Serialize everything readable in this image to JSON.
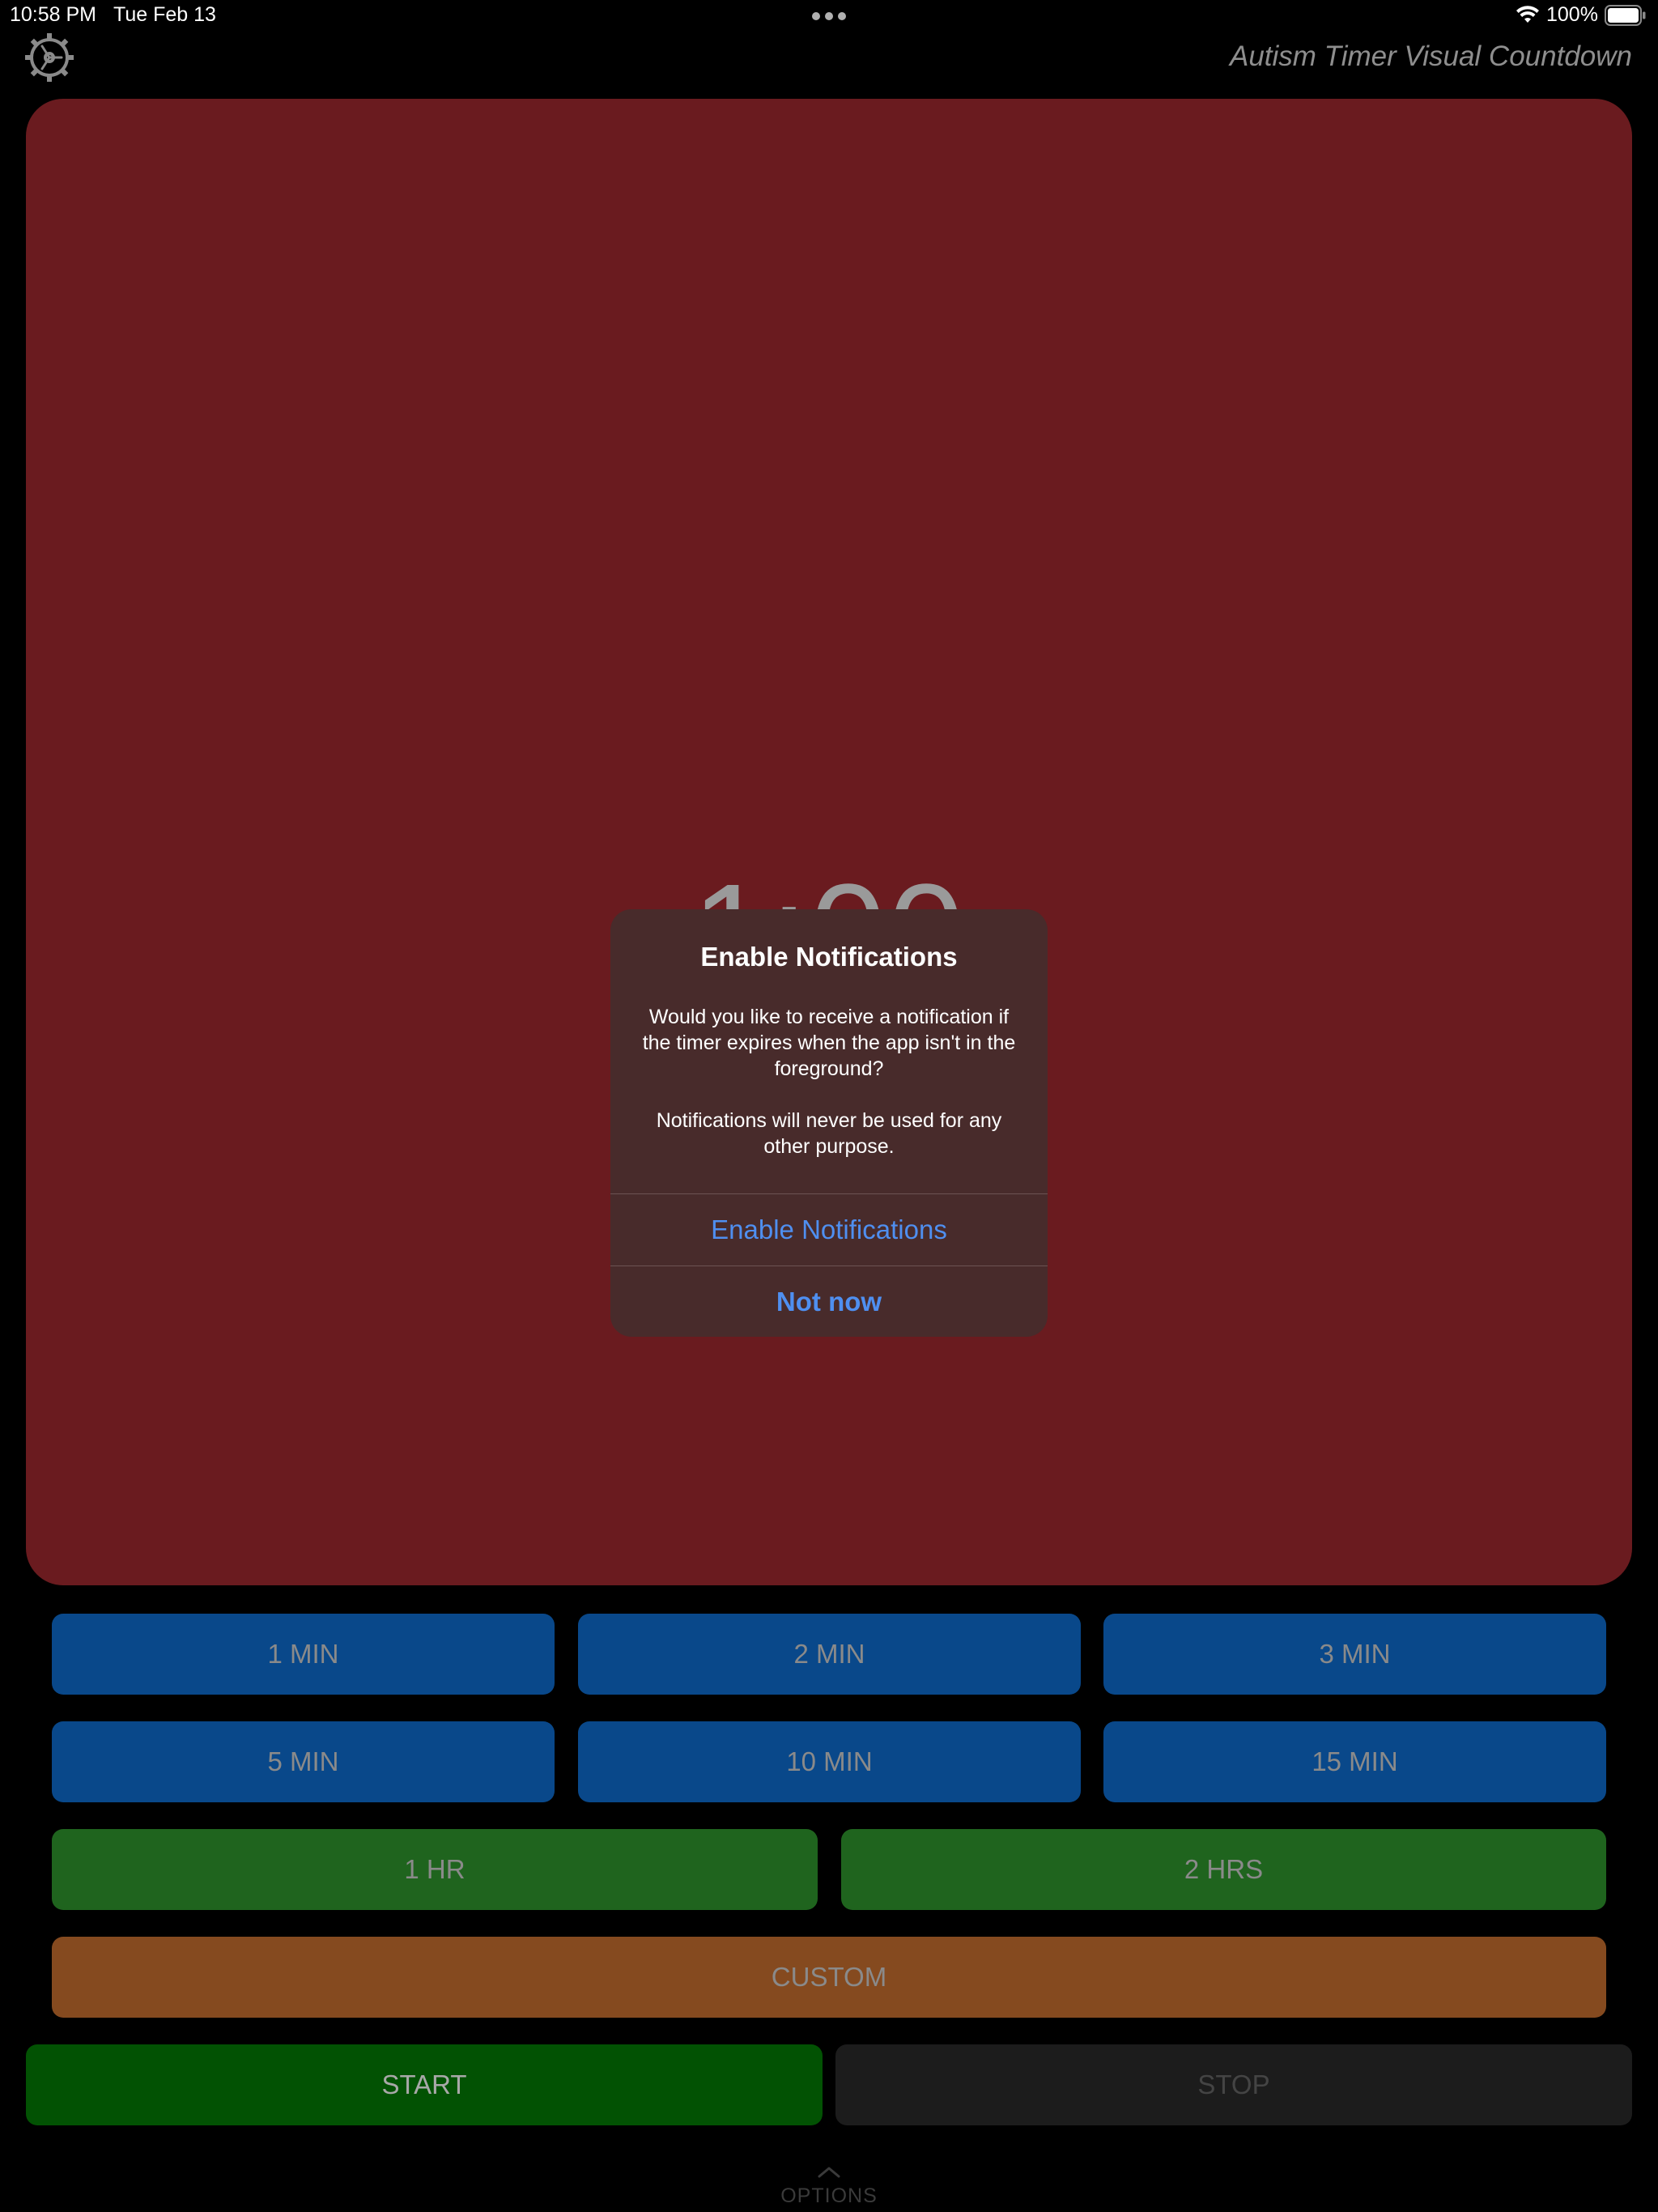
{
  "status_bar": {
    "time": "10:58 PM",
    "date": "Tue Feb 13",
    "battery_percent": "100%",
    "icons": [
      "multitask-dots",
      "wifi-icon",
      "battery-icon"
    ]
  },
  "header": {
    "settings_icon": "gear-icon",
    "title": "Autism Timer Visual Countdown"
  },
  "timer": {
    "display": "1:00",
    "panel_color": "#6a1b1f"
  },
  "alert": {
    "title": "Enable Notifications",
    "message": "Would you like to receive a notification if the timer expires when the app isn't in the foreground?\n\nNotifications will never be used for any other purpose.",
    "primary_button": "Enable Notifications",
    "secondary_button": "Not now"
  },
  "presets": {
    "row1": [
      "1 MIN",
      "2 MIN",
      "3 MIN"
    ],
    "row2": [
      "5 MIN",
      "10 MIN",
      "15 MIN"
    ],
    "row3": [
      "1 HR",
      "2 HRS"
    ],
    "custom": "CUSTOM"
  },
  "controls": {
    "start": "START",
    "stop": "STOP"
  },
  "footer": {
    "options_label": "OPTIONS",
    "chevron_icon": "chevron-up-icon"
  },
  "colors": {
    "preset_blue": "#09488a",
    "preset_green": "#1f641e",
    "custom_orange": "#854a1f",
    "start_green": "#025203",
    "stop_gray": "#1c1c1c",
    "alert_link_blue": "#4f8ff0"
  }
}
